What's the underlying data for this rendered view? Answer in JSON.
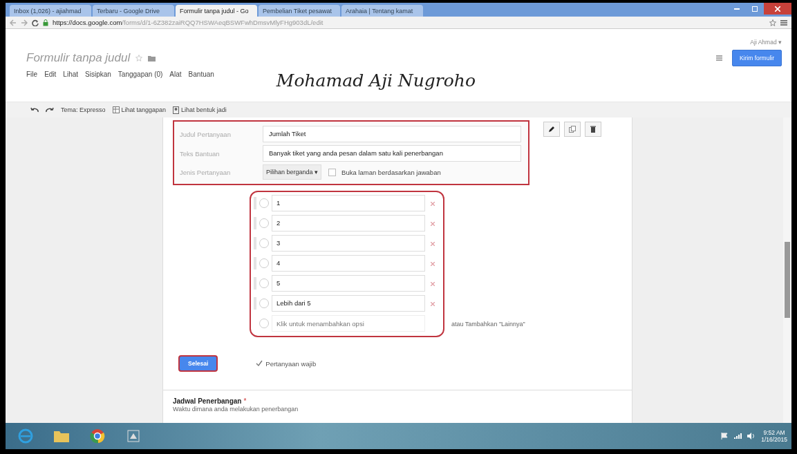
{
  "browser": {
    "tabs": [
      {
        "title": "Inbox (1,026) - ajiahmad",
        "selected": false
      },
      {
        "title": "Terbaru - Google Drive",
        "selected": false
      },
      {
        "title": "Formulir tanpa judul - Go",
        "selected": true
      },
      {
        "title": "Pembelian Tiket pesawat",
        "selected": false
      },
      {
        "title": "Arahaia | Tentang kamat",
        "selected": false
      }
    ],
    "url_host": "https://docs.google.com",
    "url_path": "/forms/d/1-6Z382zaiRQQ7HSWAeqBSWFwhDmsvMlyFHg903dL/edit"
  },
  "header": {
    "title": "Formulir tanpa judul",
    "menu": [
      "File",
      "Edit",
      "Lihat",
      "Sisipkan",
      "Tanggapan (0)",
      "Alat",
      "Bantuan"
    ],
    "signature": "Mohamad Aji Nugroho",
    "user": "Aji Ahmad ▾",
    "send_button": "Kirim formulir"
  },
  "toolbar": {
    "theme": "Tema: Expresso",
    "responses": "Lihat tanggapan",
    "preview": "Lihat bentuk jadi"
  },
  "question": {
    "fields": [
      {
        "label": "Judul Pertanyaan",
        "value": "Jumlah Tiket"
      },
      {
        "label": "Teks Bantuan",
        "value": "Banyak tiket yang anda pesan dalam satu kali penerbangan"
      }
    ],
    "type_label": "Jenis Pertanyaan",
    "type_value": "Pilihan berganda ▾",
    "page_nav": {
      "label": "Buka laman berdasarkan jawaban",
      "checked": false
    },
    "options": [
      {
        "text": "1",
        "selected": false
      },
      {
        "text": "2",
        "selected": false
      },
      {
        "text": "3",
        "selected": false
      },
      {
        "text": "4",
        "selected": false
      },
      {
        "text": "5",
        "selected": false
      },
      {
        "text": "Lebih dari 5",
        "selected": false
      }
    ],
    "add_option": {
      "placeholder": "Klik untuk menambahkan opsi",
      "selected": false
    },
    "add_other": "atau Tambahkan \"Lainnya\"",
    "done_button": "Selesai",
    "required": {
      "label": "Pertanyaan wajib",
      "checked": true
    }
  },
  "next_question": {
    "title": "Jadwal Penerbangan",
    "required_mark": "*",
    "help": "Waktu dimana anda melakukan penerbangan"
  },
  "taskbar": {
    "time": "9:52 AM",
    "date": "1/16/2015"
  }
}
